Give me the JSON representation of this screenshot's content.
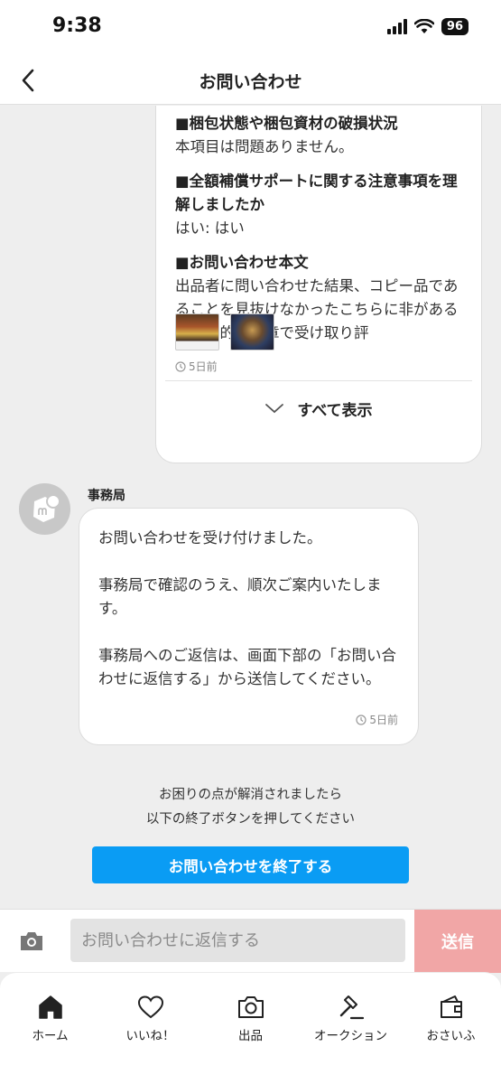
{
  "status": {
    "time": "9:38",
    "battery": "96"
  },
  "header": {
    "title": "お問い合わせ"
  },
  "user_message": {
    "sections": [
      {
        "heading": "■梱包状態や梱包資材の破損状況",
        "text": "本項目は問題ありません。"
      },
      {
        "heading": "■全額補償サポートに関する注意事項を理解しましたか",
        "text": "はい: はい"
      },
      {
        "heading": "■お問い合わせ本文",
        "text": "出品者に問い合わせた結果、コピー品であることを見抜けなかったこちらに非があると攻撃的な文章で受け取り評"
      }
    ],
    "timestamp": "5日前",
    "show_all_label": "すべて表示"
  },
  "office_message": {
    "sender": "事務局",
    "paragraphs": [
      "お問い合わせを受け付けました。",
      "事務局で確認のうえ、順次ご案内いたします。",
      "事務局へのご返信は、画面下部の「お問い合わせに返信する」から送信してください。"
    ],
    "timestamp": "5日前"
  },
  "notice": {
    "line1": "お困りの点が解消されましたら",
    "line2": "以下の終了ボタンを押してください"
  },
  "end_button_label": "お問い合わせを終了する",
  "reply": {
    "placeholder": "お問い合わせに返信する",
    "send_label": "送信"
  },
  "colors": {
    "primary_blue": "#0a9cf4",
    "send_disabled": "#f1a6a6"
  },
  "tabs": [
    {
      "label": "ホーム",
      "icon": "home-icon"
    },
    {
      "label": "いいね！",
      "icon": "heart-icon"
    },
    {
      "label": "出品",
      "icon": "camera-icon"
    },
    {
      "label": "オークション",
      "icon": "gavel-icon"
    },
    {
      "label": "おさいふ",
      "icon": "wallet-icon"
    }
  ]
}
